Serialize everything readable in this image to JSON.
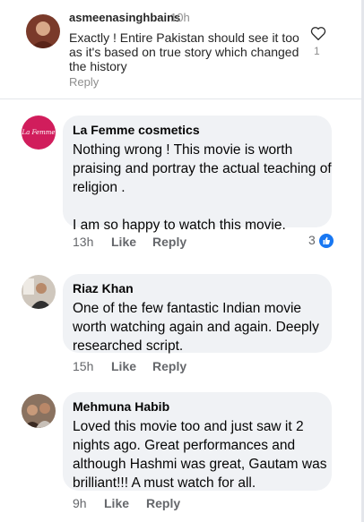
{
  "comments": [
    {
      "author": "asmeenasinghbains",
      "time": "10h",
      "text": "Exactly ! Entire Pakistan should see it too as it's based on true story which changed the history",
      "reply": "Reply",
      "likes": "1"
    },
    {
      "author": "La Femme cosmetics",
      "avatar_text": "La Femme",
      "text": "Nothing wrong ! This  movie is worth praising and portray the actual teaching of religion .\n\nI am so happy to watch this movie.",
      "time": "13h",
      "like": "Like",
      "reply": "Reply",
      "reactions": "3"
    },
    {
      "author": "Riaz Khan",
      "text": "One of the few fantastic Indian movie worth watching again and again. Deeply researched script.",
      "time": "15h",
      "like": "Like",
      "reply": "Reply"
    },
    {
      "author": "Mehmuna Habib",
      "text": "Loved this movie too and just saw it 2 nights ago. Great performances and although Hashmi was great, Gautam was brilliant!!! A must watch for all.",
      "time": "9h",
      "like": "Like",
      "reply": "Reply"
    }
  ],
  "colors": {
    "brand_pink": "#d11d5c",
    "like_blue": "#1877f2",
    "bubble_gray": "#f0f2f5"
  },
  "icons": [
    "heart-outline-icon",
    "like-thumb-icon"
  ]
}
